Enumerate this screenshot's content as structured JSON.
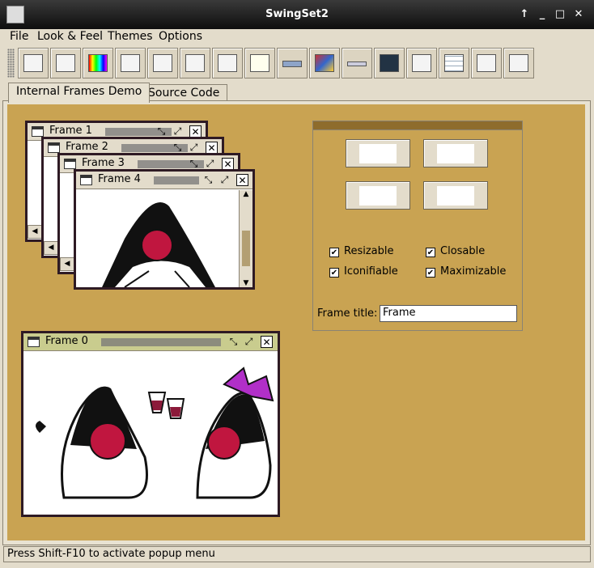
{
  "window": {
    "title": "SwingSet2"
  },
  "menu": [
    "File",
    "Look & Feel",
    "Themes",
    "Options"
  ],
  "toolbar": {
    "buttons": [
      "internal-frame-demo",
      "button-demo",
      "color-chooser-demo",
      "combobox-demo",
      "file-chooser-demo",
      "editor-pane-demo",
      "list-demo",
      "option-pane-demo",
      "progress-bar-demo",
      "scroll-pane-demo",
      "slider-demo",
      "split-pane-demo",
      "tabbed-pane-demo",
      "table-demo",
      "tooltip-demo",
      "tree-demo"
    ]
  },
  "tabs": [
    "Internal Frames Demo",
    "Source Code"
  ],
  "frames": [
    {
      "title": "Frame 0",
      "active": true
    },
    {
      "title": "Frame 1"
    },
    {
      "title": "Frame 2"
    },
    {
      "title": "Frame 3"
    },
    {
      "title": "Frame 4"
    }
  ],
  "panel": {
    "checkboxes": [
      {
        "label": "Resizable",
        "checked": true
      },
      {
        "label": "Closable",
        "checked": true
      },
      {
        "label": "Iconifiable",
        "checked": true
      },
      {
        "label": "Maximizable",
        "checked": true
      }
    ],
    "frame_title_label": "Frame title:",
    "frame_title_value": "Frame"
  },
  "status": "Press Shift-F10 to activate popup menu",
  "colors": {
    "desktop": "#c9a352",
    "active_titlebar": "#c9cc8e",
    "frame_border": "#2e1a24",
    "duke_nose": "#c0163f"
  }
}
